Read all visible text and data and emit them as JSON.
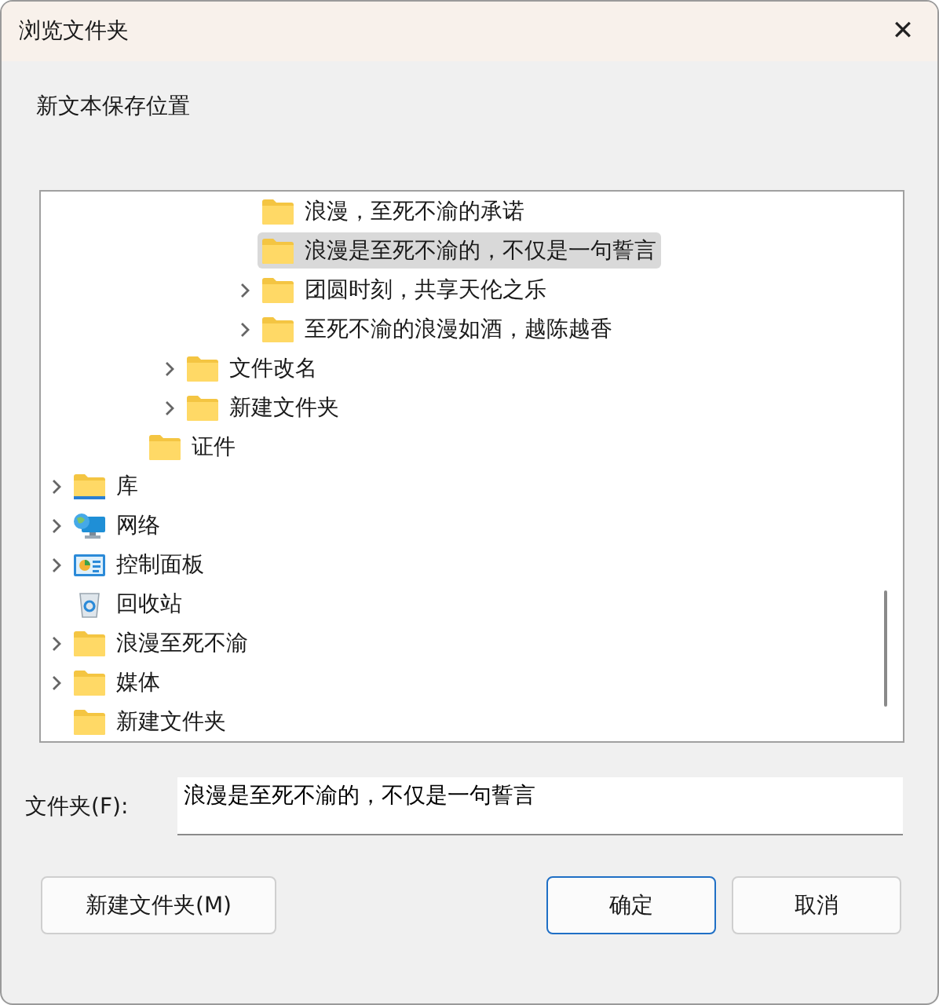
{
  "window": {
    "title": "浏览文件夹",
    "close": "✕"
  },
  "prompt": "新文本保存位置",
  "tree": {
    "items": [
      {
        "children": [
          {
            "children": [
              {
                "children": [
                  {
                    "children": [
                      {
                        "children": [
                          {
                            "label": "浪漫，至死不渝的承诺",
                            "kind": "folder",
                            "expandable": false,
                            "selected": false
                          },
                          {
                            "label": "浪漫是至死不渝的，不仅是一句誓言",
                            "kind": "folder",
                            "expandable": false,
                            "selected": true
                          },
                          {
                            "label": "团圆时刻，共享天伦之乐",
                            "kind": "folder",
                            "expandable": true,
                            "selected": false
                          },
                          {
                            "label": "至死不渝的浪漫如酒，越陈越香",
                            "kind": "folder",
                            "expandable": true,
                            "selected": false
                          }
                        ]
                      }
                    ]
                  },
                  {
                    "label": "文件改名",
                    "kind": "folder",
                    "expandable": true,
                    "selected": false
                  },
                  {
                    "label": "新建文件夹",
                    "kind": "folder",
                    "expandable": true,
                    "selected": false
                  }
                ]
              },
              {
                "label": "证件",
                "kind": "folder",
                "expandable": false,
                "selected": false
              }
            ]
          }
        ]
      },
      {
        "label": "库",
        "kind": "library",
        "expandable": true,
        "selected": false
      },
      {
        "label": "网络",
        "kind": "network",
        "expandable": true,
        "selected": false
      },
      {
        "label": "控制面板",
        "kind": "control-panel",
        "expandable": true,
        "selected": false
      },
      {
        "label": "回收站",
        "kind": "recycle-bin",
        "expandable": false,
        "selected": false
      },
      {
        "label": "浪漫至死不渝",
        "kind": "folder",
        "expandable": true,
        "selected": false
      },
      {
        "label": "媒体",
        "kind": "folder",
        "expandable": true,
        "selected": false
      },
      {
        "label": "新建文件夹",
        "kind": "folder",
        "expandable": false,
        "selected": false
      }
    ]
  },
  "folder_field": {
    "label": "文件夹(F):",
    "value": "浪漫是至死不渝的，不仅是一句誓言"
  },
  "buttons": [
    {
      "label": "新建文件夹(M)",
      "kind": "normal"
    },
    {
      "label": "确定",
      "kind": "default"
    },
    {
      "label": "取消",
      "kind": "normal"
    }
  ]
}
